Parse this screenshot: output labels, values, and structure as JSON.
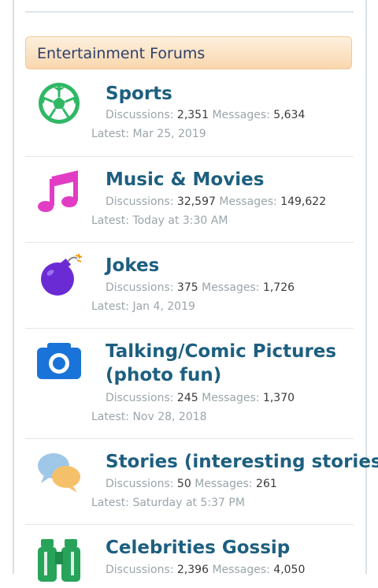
{
  "category": {
    "title": "Entertainment Forums"
  },
  "labels": {
    "discussions": "Discussions:",
    "messages": "Messages:",
    "latest": "Latest:"
  },
  "forums": [
    {
      "title": "Sports",
      "icon": "soccer-ball-icon",
      "discussions": "2,351",
      "messages": "5,634",
      "latest": "Mar 25, 2019"
    },
    {
      "title": "Music & Movies",
      "icon": "music-note-icon",
      "discussions": "32,597",
      "messages": "149,622",
      "latest": "Today at 3:30 AM"
    },
    {
      "title": "Jokes",
      "icon": "bomb-icon",
      "discussions": "375",
      "messages": "1,726",
      "latest": "Jan 4, 2019"
    },
    {
      "title": "Talking/Comic Pictures (photo fun)",
      "icon": "camera-icon",
      "discussions": "245",
      "messages": "1,370",
      "latest": "Nov 28, 2018"
    },
    {
      "title": "Stories (interesting stories)",
      "icon": "speech-bubbles-icon",
      "discussions": "50",
      "messages": "261",
      "latest": "Saturday at 5:37 PM"
    },
    {
      "title": "Celebrities Gossip",
      "icon": "binoculars-icon",
      "discussions": "2,396",
      "messages": "4,050",
      "latest": ""
    }
  ]
}
